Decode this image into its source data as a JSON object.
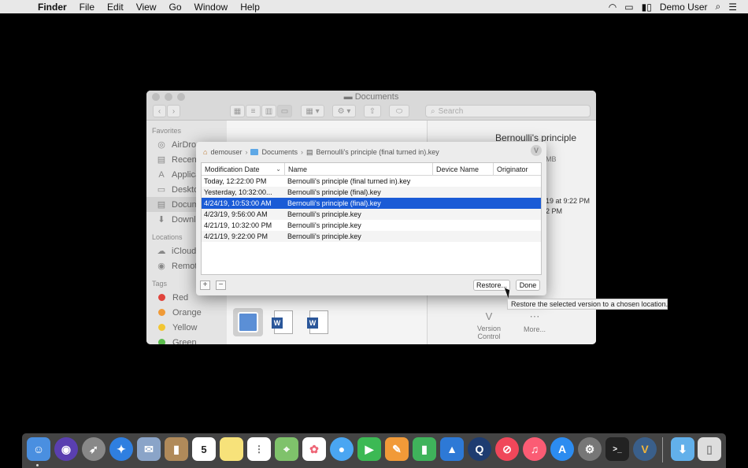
{
  "menubar": {
    "app": "Finder",
    "items": [
      "File",
      "Edit",
      "View",
      "Go",
      "Window",
      "Help"
    ],
    "user": "Demo User"
  },
  "finder": {
    "title": "Documents",
    "search_placeholder": "Search",
    "sidebar": {
      "favorites_label": "Favorites",
      "favorites": [
        "AirDrop",
        "Recent",
        "Applica",
        "Deskto",
        "Docum",
        "Downlo"
      ],
      "locations_label": "Locations",
      "locations": [
        "iCloud",
        "Remote"
      ],
      "tags_label": "Tags",
      "tags": [
        {
          "label": "Red",
          "color": "#e0443c"
        },
        {
          "label": "Orange",
          "color": "#f09a37"
        },
        {
          "label": "Yellow",
          "color": "#f2c633"
        },
        {
          "label": "Green",
          "color": "#5bbd4c"
        }
      ]
    },
    "preview": {
      "title": "Bernoulli's principle in).key",
      "size": "MB",
      "date1": "19 at 9:22 PM",
      "date2": "2 PM",
      "action1": "Version Control",
      "action2": "More..."
    }
  },
  "sheet": {
    "breadcrumb": [
      "demouser",
      "Documents",
      "Bernoulli's principle (final turned in).key"
    ],
    "columns": [
      "Modification Date",
      "Name",
      "Device Name",
      "Originator"
    ],
    "rows": [
      {
        "date": "Today, 12:22:00 PM",
        "name": "Bernoulli's principle (final turned in).key",
        "device": "",
        "originator": ""
      },
      {
        "date": "Yesterday, 10:32:00...",
        "name": "Bernoulli's principle (final).key",
        "device": "",
        "originator": ""
      },
      {
        "date": "4/24/19, 10:53:00 AM",
        "name": "Bernoulli's principle (final).key",
        "device": "",
        "originator": ""
      },
      {
        "date": "4/23/19, 9:56:00 AM",
        "name": "Bernoulli's principle.key",
        "device": "",
        "originator": ""
      },
      {
        "date": "4/21/19, 10:32:00 PM",
        "name": "Bernoulli's principle.key",
        "device": "",
        "originator": ""
      },
      {
        "date": "4/21/19, 9:22:00 PM",
        "name": "Bernoulli's principle.key",
        "device": "",
        "originator": ""
      }
    ],
    "selected_row": 2,
    "add": "+",
    "remove": "−",
    "restore": "Restore...",
    "done": "Done"
  },
  "tooltip": "Restore the selected version to a chosen location.",
  "dock": {
    "calendar_day": "5",
    "icons": [
      "finder-icon",
      "siri-icon",
      "launchpad-icon",
      "safari-icon",
      "mail-stamp-icon",
      "contacts-icon",
      "calendar-icon",
      "notes-icon",
      "reminders-icon",
      "maps-icon",
      "photos-icon",
      "messages-icon",
      "facetime-icon",
      "pages-icon",
      "numbers-icon",
      "keynote-icon",
      "quicktime-icon",
      "news-icon",
      "music-icon",
      "app-store-icon",
      "system-preferences-icon",
      "terminal-icon",
      "versions-app-icon",
      "downloads-folder-icon",
      "trash-icon"
    ]
  }
}
